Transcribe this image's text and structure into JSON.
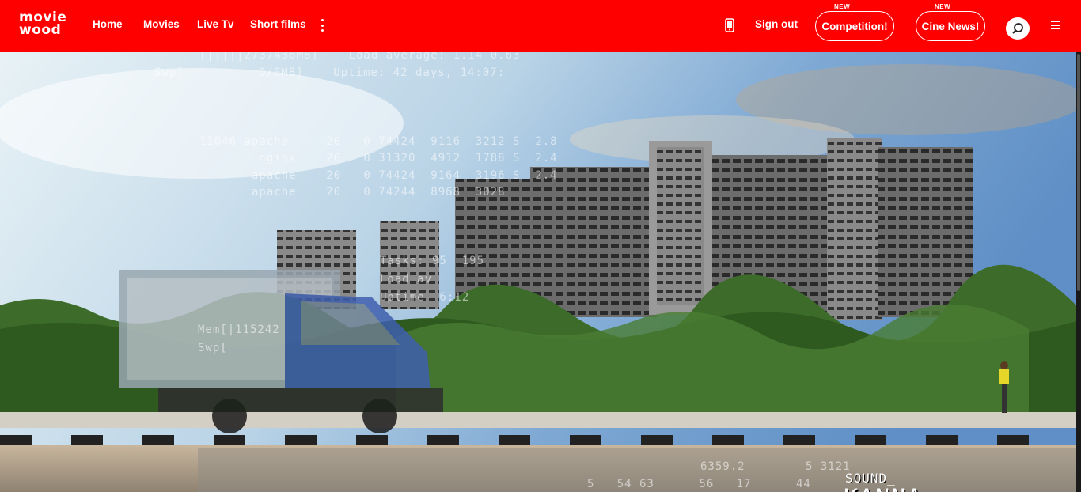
{
  "brand": {
    "logo_line1": "movie",
    "logo_line2": "wood"
  },
  "nav": {
    "items": [
      {
        "label": "Home"
      },
      {
        "label": "Movies"
      },
      {
        "label": "Live Tv"
      },
      {
        "label": "Short films"
      }
    ],
    "more_icon": "kebab-icon"
  },
  "header_right": {
    "phone_icon": "phone-icon",
    "sign_out": "Sign out",
    "competition": {
      "label": "Competition!",
      "badge": "NEW"
    },
    "cine_news": {
      "label": "Cine News!",
      "badge": "NEW"
    },
    "search_icon": "search-icon",
    "menu_icon": "hamburger-menu-icon"
  },
  "hero": {
    "credit_role": "SOUND_",
    "credit_name": "KANNA_",
    "terminal_lines": [
      "[|||||2737436MB]    Load average: 1.14 0.63",
      "Swp[          0/0MB]    Uptime: 42 days, 14:07:",
      "11046 apache     20   0 74424  9116  3212 S  2.8",
      "        nginx    20   0 31320  4912  1788 S  2.4",
      "       apache    20   0 74424  9164  3196 S  2.4",
      "       apache    20   0 74244  8968  3028",
      "Tasks: 95  195",
      "Load av",
      "Uptime  6:12",
      "Mem[|115242",
      "Swp["
    ],
    "bottom_readout": "6359.2",
    "bottom_codes": "5 3121",
    "bottom_codes_2": "5   54 63      56   17      44"
  },
  "colors": {
    "brand_red": "#ff0000",
    "white": "#ffffff"
  }
}
